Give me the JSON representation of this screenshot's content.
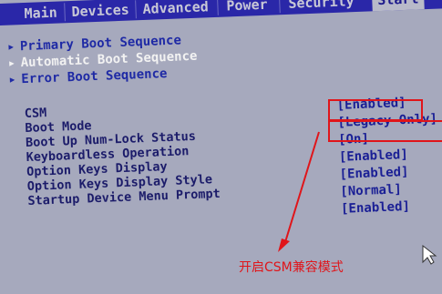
{
  "menu": [
    "Main",
    "Devices",
    "Advanced",
    "Power",
    "Security",
    "Start"
  ],
  "nav_items": [
    {
      "label": "Primary Boot Sequence"
    },
    {
      "label": "Automatic Boot Sequence"
    },
    {
      "label": "Error Boot Sequence"
    }
  ],
  "settings": [
    {
      "label": "CSM",
      "value": "[Enabled]"
    },
    {
      "label": "Boot Mode",
      "value": "[Legacy Only]"
    },
    {
      "label": "Boot Up Num-Lock Status",
      "value": "[On]"
    },
    {
      "label": "Keyboardless Operation",
      "value": "[Enabled]"
    },
    {
      "label": "Option Keys Display",
      "value": "[Enabled]"
    },
    {
      "label": "Option Keys Display Style",
      "value": "[Normal]"
    },
    {
      "label": "Startup Device Menu Prompt",
      "value": "[Enabled]"
    }
  ],
  "annotation": "开启CSM兼容模式",
  "colors": {
    "accent": "#e0151a",
    "menubar": "#2a27a8",
    "background": "#a6a9bd"
  }
}
